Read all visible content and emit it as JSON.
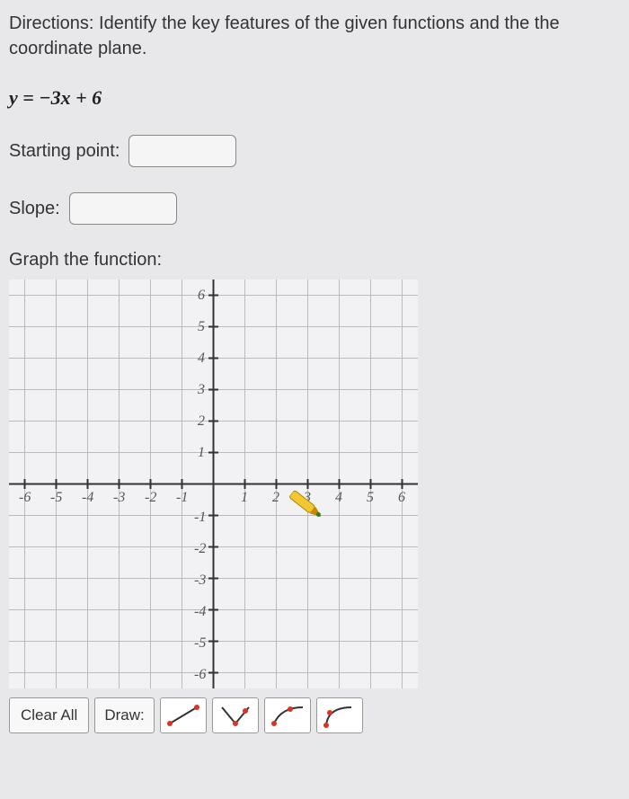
{
  "directions": "Directions: Identify the key features of the given functions and the the coordinate plane.",
  "equation": "y = −3x + 6",
  "fields": {
    "startingPointLabel": "Starting point:",
    "startingPointValue": "",
    "slopeLabel": "Slope:",
    "slopeValue": ""
  },
  "graph": {
    "label": "Graph the function:",
    "xTicks": [
      "-6",
      "-5",
      "-4",
      "-3",
      "-2",
      "-1",
      "1",
      "2",
      "3",
      "4",
      "5",
      "6"
    ],
    "yTicksPos": [
      "1",
      "2",
      "3",
      "4",
      "5",
      "6"
    ],
    "yTicksNeg": [
      "-1",
      "-2",
      "-3",
      "-4",
      "-5",
      "-6"
    ]
  },
  "tools": {
    "clearAll": "Clear All",
    "drawLabel": "Draw:"
  },
  "icons": {
    "line": "line-tool-icon",
    "absval": "absval-tool-icon",
    "sqrt": "sqrt-tool-icon",
    "curve": "curve-tool-icon"
  }
}
